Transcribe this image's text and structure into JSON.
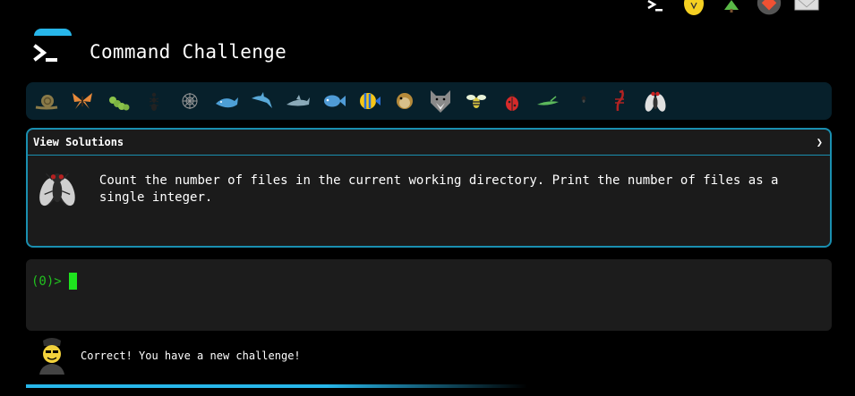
{
  "app": {
    "title": "Command Challenge"
  },
  "top_icons": [
    "terminal-icon",
    "lightbulb-icon",
    "tree-icon",
    "git-icon",
    "mail-icon"
  ],
  "critters": [
    "snail",
    "butterfly",
    "caterpillar",
    "ant",
    "spider-web",
    "whale",
    "dolphin",
    "dolphin-jump",
    "fish",
    "tropical-fish",
    "blowfish",
    "wolf",
    "bee",
    "ladybug",
    "cricket",
    "spider",
    "scorpion",
    "fly"
  ],
  "panel": {
    "header": "View Solutions",
    "chevron": "❯",
    "challenge": "Count the number of files in the current working directory. Print the number of files as a single integer."
  },
  "terminal": {
    "prompt": "(0)>"
  },
  "status": {
    "message": "Correct! You have a new challenge!"
  },
  "colors": {
    "accent": "#27b6ea",
    "prompt": "#21c21f",
    "cursor": "#1ee31e",
    "panel_border": "#1a8fb0"
  }
}
